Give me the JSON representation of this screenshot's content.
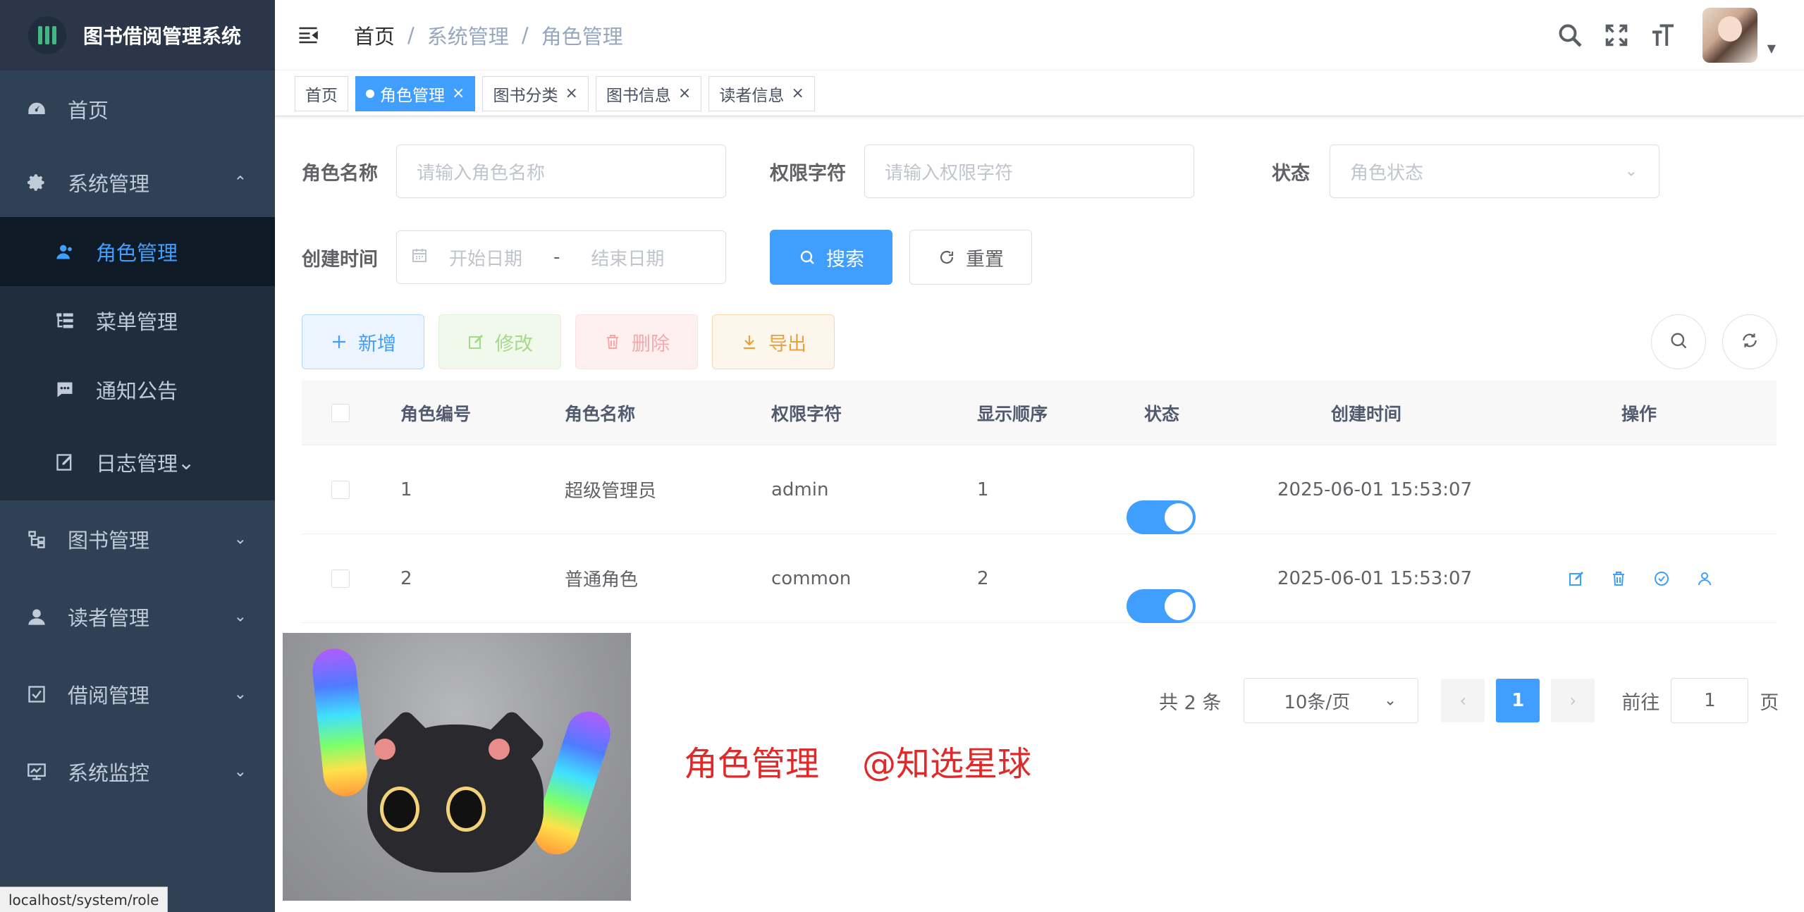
{
  "app": {
    "title": "图书借阅管理系统"
  },
  "sidebar": {
    "items": [
      {
        "label": "首页"
      },
      {
        "label": "系统管理",
        "children": [
          {
            "label": "角色管理"
          },
          {
            "label": "菜单管理"
          },
          {
            "label": "通知公告"
          },
          {
            "label": "日志管理"
          }
        ]
      },
      {
        "label": "图书管理"
      },
      {
        "label": "读者管理"
      },
      {
        "label": "借阅管理"
      },
      {
        "label": "系统监控"
      }
    ]
  },
  "breadcrumb": [
    "首页",
    "系统管理",
    "角色管理"
  ],
  "tags": [
    {
      "label": "首页",
      "active": false
    },
    {
      "label": "角色管理",
      "active": true
    },
    {
      "label": "图书分类",
      "active": false
    },
    {
      "label": "图书信息",
      "active": false
    },
    {
      "label": "读者信息",
      "active": false
    }
  ],
  "search": {
    "role_name_label": "角色名称",
    "role_name_placeholder": "请输入角色名称",
    "perm_label": "权限字符",
    "perm_placeholder": "请输入权限字符",
    "status_label": "状态",
    "status_placeholder": "角色状态",
    "created_label": "创建时间",
    "start_placeholder": "开始日期",
    "range_sep": "-",
    "end_placeholder": "结束日期",
    "search_btn": "搜索",
    "reset_btn": "重置"
  },
  "toolbar": {
    "add": "新增",
    "edit": "修改",
    "delete": "删除",
    "export": "导出"
  },
  "table": {
    "columns": [
      "角色编号",
      "角色名称",
      "权限字符",
      "显示顺序",
      "状态",
      "创建时间",
      "操作"
    ],
    "rows": [
      {
        "id": "1",
        "name": "超级管理员",
        "key": "admin",
        "sort": "1",
        "status": true,
        "created": "2025-06-01 15:53:07"
      },
      {
        "id": "2",
        "name": "普通角色",
        "key": "common",
        "sort": "2",
        "status": true,
        "created": "2025-06-01 15:53:07"
      }
    ]
  },
  "pagination": {
    "total": "共 2 条",
    "page_size": "10条/页",
    "current": "1",
    "goto": "前往",
    "goto_value": "1",
    "page_unit": "页"
  },
  "caption": "角色管理    @知选星球",
  "status_bar": "localhost/system/role",
  "colors": {
    "primary": "#409eff",
    "sidebar_bg": "#304156",
    "sidebar_active_bg": "#0f1a27",
    "caption": "#e02a2a"
  }
}
